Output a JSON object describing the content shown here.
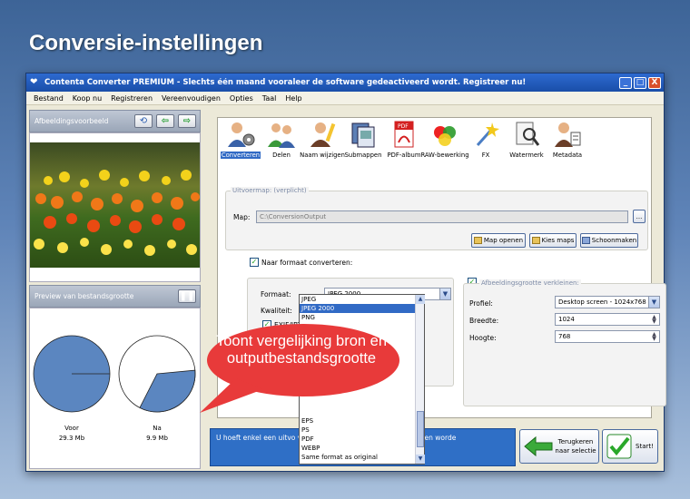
{
  "heading": "Conversie-instellingen",
  "window": {
    "title": "Contenta Converter PREMIUM - Slechts één maand vooraleer de software gedeactiveerd wordt. Registreer nu!",
    "controls": [
      "_",
      "□",
      "X"
    ]
  },
  "menu": [
    "Bestand",
    "Koop nu",
    "Registreren",
    "Vereenvoudigen",
    "Opties",
    "Taal",
    "Help"
  ],
  "left": {
    "preview_label": "Afbeeldingsvoorbeeld",
    "size_label": "Preview van bestandsgrootte",
    "before_label": "Voor",
    "before_size": "29.3 Mb",
    "after_label": "Na",
    "after_size": "9.9 Mb",
    "after_fraction": 0.34
  },
  "toolbar": [
    {
      "label": "Converteren",
      "icon": "person-gear-icon"
    },
    {
      "label": "Delen",
      "icon": "people-share-icon"
    },
    {
      "label": "Naam wijzigen",
      "icon": "rename-icon"
    },
    {
      "label": "Submappen",
      "icon": "subfolders-icon"
    },
    {
      "label": "PDF-album",
      "icon": "pdf-icon"
    },
    {
      "label": "RAW-bewerking",
      "icon": "raw-icon"
    },
    {
      "label": "FX",
      "icon": "fx-icon"
    },
    {
      "label": "Watermerk",
      "icon": "watermark-icon"
    },
    {
      "label": "Metadata",
      "icon": "metadata-icon"
    }
  ],
  "output": {
    "legend": "Uitvoermap: (verplicht)",
    "map_label": "Map:",
    "path": "C:\\ConversionOutput",
    "browse": "...",
    "open_map": "Map openen",
    "choose_maps": "Kies maps",
    "clean_maps": "Schoonmaken"
  },
  "convert": {
    "checkbox_label": "Naar formaat converteren:",
    "format_label": "Formaat:",
    "format_value": "JPEG 2000",
    "quality_label": "Kwaliteit:",
    "exif_label": "EXIF/IPTC/XMP-m",
    "options": [
      "JPEG",
      "JPEG 2000",
      "PNG",
      "EPS",
      "PS",
      "PDF",
      "WEBP",
      "Same format as original"
    ],
    "selected_option": "JPEG 2000"
  },
  "resize": {
    "legend": "Afbeeldingsgrootte verkleinen:",
    "profile_label": "Profiel:",
    "profile_value": "Desktop screen - 1024x768",
    "width_label": "Breedte:",
    "width_value": "1024",
    "height_label": "Hoogte:",
    "height_value": "768"
  },
  "info_text": "U hoeft enkel een uitvo                                              verteerde bestanden opgeslagen zullen worde",
  "back_button": "Terugkeren naar selectie",
  "start_button": "Start!",
  "callout": "Toont vergelijking bron en outputbestandsgrootte",
  "colors": {
    "accent": "#316ac5",
    "callout": "#e83a3a",
    "pie": "#5b86c0"
  }
}
